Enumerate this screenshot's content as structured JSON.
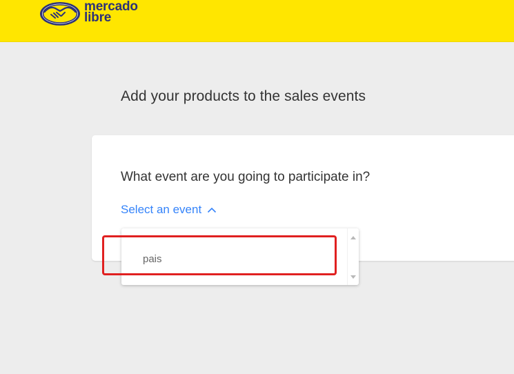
{
  "header": {
    "logo_line1": "mercado",
    "logo_line2": "libre",
    "background_color": "#ffe600",
    "logo_color": "#2d3277"
  },
  "main": {
    "title": "Add your products to the sales events"
  },
  "card": {
    "question": "What event are you going to participate in?",
    "select": {
      "label": "Select an event",
      "icon": "chevron-up-icon",
      "expanded": true,
      "accent_color": "#3483fa"
    },
    "dropdown": {
      "options": [
        "pais"
      ]
    }
  },
  "annotation": {
    "type": "highlight-box",
    "color": "#e02020"
  }
}
